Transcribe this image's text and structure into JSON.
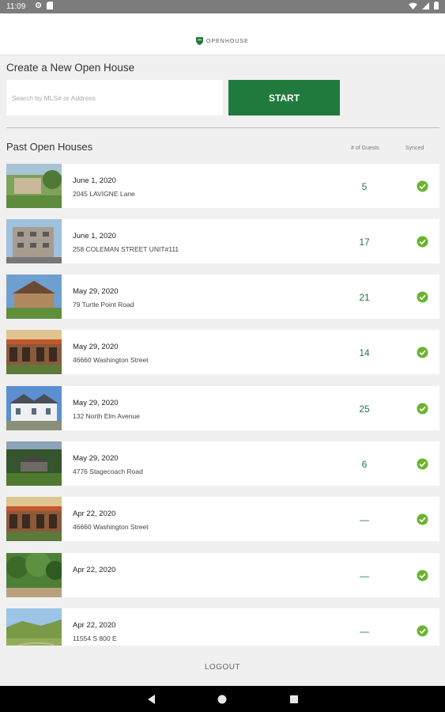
{
  "status_bar": {
    "time": "11:09",
    "icons": [
      "gear-icon",
      "sd-card-icon"
    ],
    "right_icons": [
      "wifi-icon",
      "signal-icon",
      "battery-icon"
    ]
  },
  "app": {
    "logo_text": "OPENHOUSE",
    "brand_color": "#217a3d"
  },
  "create": {
    "title": "Create a New Open House",
    "search_placeholder": "Search by MLS# or Address",
    "search_value": "",
    "start_label": "START"
  },
  "past": {
    "title": "Past Open Houses",
    "col_guests": "# of Guests",
    "col_synced": "Synced",
    "items": [
      {
        "date": "June 1, 2020",
        "address": "2045 LAVIGNE Lane",
        "guests": "5",
        "synced": true
      },
      {
        "date": "June 1, 2020",
        "address": "258 COLEMAN STREET UNIT#111",
        "guests": "17",
        "synced": true
      },
      {
        "date": "May 29, 2020",
        "address": "79 Turtle Point Road",
        "guests": "21",
        "synced": true
      },
      {
        "date": "May 29, 2020",
        "address": "46660 Washington Street",
        "guests": "14",
        "synced": true
      },
      {
        "date": "May 29, 2020",
        "address": "132 North Elm Avenue",
        "guests": "25",
        "synced": true
      },
      {
        "date": "May 29, 2020",
        "address": "4776 Stagecoach Road",
        "guests": "6",
        "synced": true
      },
      {
        "date": "Apr 22, 2020",
        "address": "46660 Washington Street",
        "guests": "—",
        "synced": true
      },
      {
        "date": "Apr 22, 2020",
        "address": "",
        "guests": "—",
        "synced": true
      },
      {
        "date": "Apr 22, 2020",
        "address": "11554 S 800 E",
        "guests": "—",
        "synced": true
      }
    ]
  },
  "footer": {
    "logout_label": "LOGOUT"
  },
  "nav": {
    "buttons": [
      "back-icon",
      "home-icon",
      "recents-icon"
    ]
  },
  "colors": {
    "synced_check": "#6ab42d",
    "guest_count": "#217a3d"
  }
}
